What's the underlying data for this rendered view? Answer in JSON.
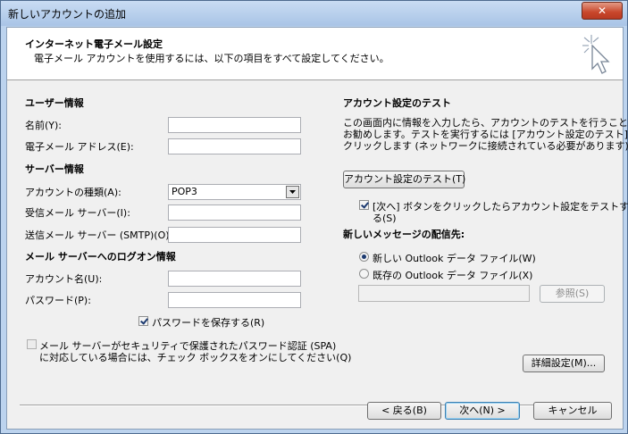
{
  "window": {
    "title": "新しいアカウントの追加",
    "close_label": "✕"
  },
  "header": {
    "title": "インターネット電子メール設定",
    "subtitle": "電子メール アカウントを使用するには、以下の項目をすべて設定してください。"
  },
  "user_info": {
    "heading": "ユーザー情報",
    "name_label": "名前(Y):",
    "name_value": "",
    "email_label": "電子メール アドレス(E):",
    "email_value": ""
  },
  "server_info": {
    "heading": "サーバー情報",
    "account_type_label": "アカウントの種類(A):",
    "account_type_value": "POP3",
    "incoming_label": "受信メール サーバー(I):",
    "incoming_value": "",
    "outgoing_label": "送信メール サーバー (SMTP)(O):",
    "outgoing_value": ""
  },
  "logon_info": {
    "heading": "メール サーバーへのログオン情報",
    "account_name_label": "アカウント名(U):",
    "account_name_value": "",
    "password_label": "パスワード(P):",
    "password_value": "",
    "save_password_label": "パスワードを保存する(R)",
    "save_password_checked": true,
    "spa_label_line1": "メール サーバーがセキュリティで保護されたパスワード認証 (SPA)",
    "spa_label_line2": "に対応している場合には、チェック ボックスをオンにしてください(Q)",
    "spa_checked": false
  },
  "test": {
    "heading": "アカウント設定のテスト",
    "description_line1": "この画面内に情報を入力したら、アカウントのテストを行うことを",
    "description_line2": "お勧めします。テストを実行するには [アカウント設定のテスト] を",
    "description_line3": "クリックします (ネットワークに接続されている必要があります)。",
    "test_button": "アカウント設定のテスト(T)",
    "next_test_label_line1": "[次へ] ボタンをクリックしたらアカウント設定をテストす",
    "next_test_label_line2": "る(S)",
    "next_test_checked": true
  },
  "delivery": {
    "heading": "新しいメッセージの配信先:",
    "option_new": "新しい Outlook データ ファイル(W)",
    "option_existing": "既存の Outlook データ ファイル(X)",
    "selected": "new",
    "existing_path": "",
    "browse_button": "参照(S)"
  },
  "more_settings_button": "詳細設定(M)...",
  "footer": {
    "back_button": "< 戻る(B)",
    "next_button": "次へ(N) >",
    "cancel_button": "キャンセル"
  }
}
